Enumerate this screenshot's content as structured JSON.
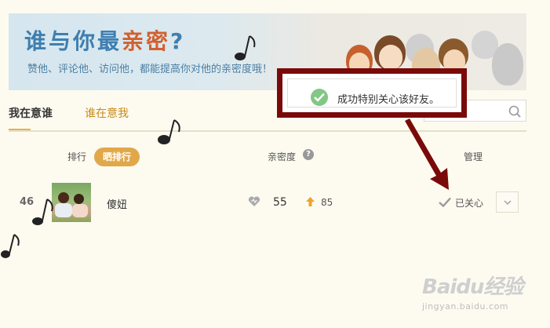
{
  "banner": {
    "title_part1": "谁与你最",
    "title_highlight": "亲密",
    "title_part2": "?",
    "subtitle": "赞他、评论他、访问他，都能提高你对他的亲密度哦！"
  },
  "tabs": [
    {
      "label": "我在意谁",
      "active": true
    },
    {
      "label": "谁在意我",
      "active": false
    }
  ],
  "search": {
    "placeholder": "",
    "icon": "search-icon"
  },
  "toast": {
    "message": "成功特别关心该好友。",
    "icon": "check-circle-icon"
  },
  "table": {
    "rank_label": "排行",
    "rank_button": "晒排行",
    "intimacy_label": "亲密度",
    "manage_label": "管理",
    "rows": [
      {
        "rank": "46",
        "name": "傻妞",
        "intimacy": "55",
        "rise": "85",
        "status": "已关心"
      }
    ]
  },
  "watermark": {
    "brand": "Baidu经验",
    "url": "jingyan.baidu.com"
  },
  "colors": {
    "accent": "#e1a84a",
    "title_blue": "#3f7fb0",
    "highlight_orange": "#d2602e",
    "annotation": "#7a0a0a",
    "success": "#82c785"
  }
}
